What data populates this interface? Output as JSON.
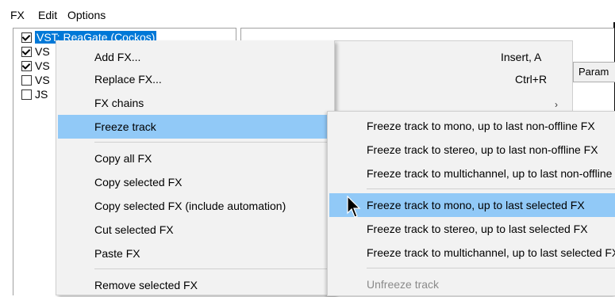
{
  "menubar": {
    "items": [
      "FX",
      "Edit",
      "Options"
    ]
  },
  "fx_list": {
    "items": [
      {
        "label": "VST: ReaGate (Cockos)",
        "checked": true,
        "selected": true
      },
      {
        "label": "VS",
        "checked": true,
        "selected": false
      },
      {
        "label": "VS",
        "checked": true,
        "selected": false
      },
      {
        "label": "VS",
        "checked": false,
        "selected": false
      },
      {
        "label": "JS",
        "checked": false,
        "selected": false
      }
    ]
  },
  "param_tab": {
    "label": "Param"
  },
  "context_menu": {
    "items": [
      {
        "label": "Add FX...",
        "shortcut": "Insert, A"
      },
      {
        "label": "Replace FX...",
        "shortcut": "Ctrl+R"
      },
      {
        "label": "FX chains",
        "shortcut": ""
      },
      {
        "label": "Freeze track",
        "shortcut": ""
      },
      {
        "label": "Copy all FX",
        "shortcut": ""
      },
      {
        "label": "Copy selected FX",
        "shortcut": ""
      },
      {
        "label": "Copy selected FX (include automation)",
        "shortcut": ""
      },
      {
        "label": "Cut selected FX",
        "shortcut": ""
      },
      {
        "label": "Paste FX",
        "shortcut": ""
      },
      {
        "label": "Remove selected FX",
        "shortcut": ""
      }
    ]
  },
  "submenu": {
    "items": [
      {
        "label": "Freeze track to mono, up to last non-offline FX"
      },
      {
        "label": "Freeze track to stereo, up to last non-offline FX"
      },
      {
        "label": "Freeze track to multichannel, up to last non-offline FX"
      },
      {
        "label": "Freeze track to mono, up to last selected FX"
      },
      {
        "label": "Freeze track to stereo, up to last selected FX"
      },
      {
        "label": "Freeze track to multichannel, up to last selected FX"
      },
      {
        "label": "Unfreeze track"
      }
    ]
  },
  "colors": {
    "highlight": "#91c9f7",
    "menu_bg": "#f2f2f2",
    "selection": "#0078d7"
  },
  "icons": {
    "arrow": "chevron-right-icon",
    "cursor": "mouse-pointer-icon",
    "check": "checkbox-check-icon"
  }
}
